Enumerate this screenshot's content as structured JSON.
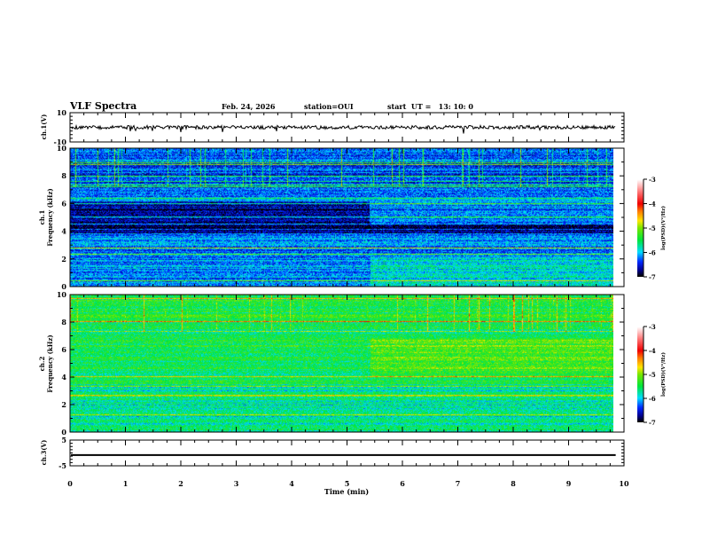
{
  "header": {
    "title": "VLF Spectra",
    "date": "Feb. 24, 2026",
    "station": "station=OUI",
    "start": "start  UT =   13: 10: 0"
  },
  "chart_data": [
    {
      "type": "line",
      "ylabel": "ch.1(V)",
      "ylim": [
        -10,
        10
      ],
      "yticks": [
        "10",
        "-10"
      ],
      "xlim": [
        0,
        10
      ],
      "trace_mean": 0,
      "trace_end_min": 9.85
    },
    {
      "type": "heatmap",
      "ylabel": "ch.1\nFrequency (kHz)",
      "ylabel_lines": [
        "ch.1",
        "Frequency (kHz)"
      ],
      "ylim": [
        0,
        10
      ],
      "yticks": [
        "0",
        "2",
        "4",
        "6",
        "8",
        "10"
      ],
      "xlim": [
        0,
        10
      ],
      "data_end_min": 9.85,
      "colorbar": {
        "label": "log(PSD)(V²/Hz)",
        "range": [
          -7,
          -3
        ],
        "ticks": [
          "-3",
          "-4",
          "-5",
          "-6",
          "-7"
        ]
      },
      "typical_level": -6.2,
      "change_time_min": 5.4
    },
    {
      "type": "heatmap",
      "ylabel_lines": [
        "ch.2",
        "Frequency (kHz)"
      ],
      "ylim": [
        0,
        10
      ],
      "yticks": [
        "0",
        "2",
        "4",
        "6",
        "8",
        "10"
      ],
      "xlim": [
        0,
        10
      ],
      "data_end_min": 9.85,
      "colorbar": {
        "label": "log(PSD)(V²/Hz)",
        "range": [
          -7,
          -3
        ],
        "ticks": [
          "-3",
          "-4",
          "-5",
          "-6",
          "-7"
        ]
      },
      "typical_level": -5.5,
      "change_time_min": 5.4
    },
    {
      "type": "line",
      "ylabel": "ch.3(V)",
      "ylim": [
        -5,
        5
      ],
      "yticks": [
        "5",
        "-5"
      ],
      "xlim": [
        0,
        10
      ],
      "trace_value": -0.8,
      "trace_end_min": 9.85,
      "xlabel": "Time (min)",
      "xticks": [
        "0",
        "1",
        "2",
        "3",
        "4",
        "5",
        "6",
        "7",
        "8",
        "9",
        "10"
      ]
    }
  ]
}
